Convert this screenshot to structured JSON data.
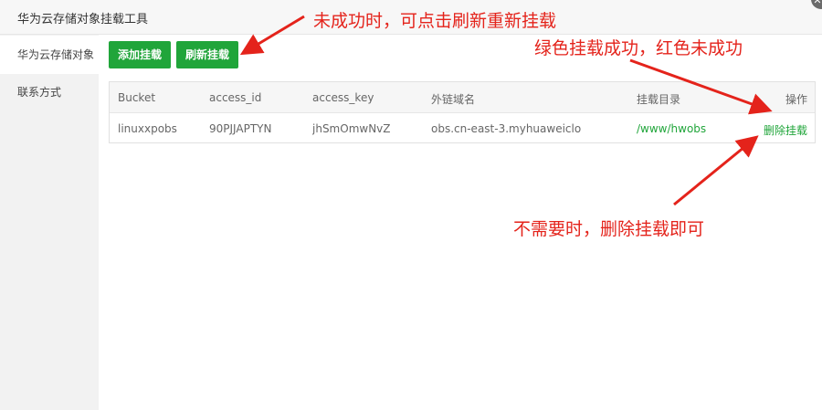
{
  "window": {
    "title": "华为云存储对象挂载工具"
  },
  "sidebar": {
    "items": [
      {
        "label": "华为云存储对象"
      },
      {
        "label": "联系方式"
      }
    ]
  },
  "toolbar": {
    "add_label": "添加挂载",
    "refresh_label": "刷新挂载"
  },
  "table": {
    "columns": [
      "Bucket",
      "access_id",
      "access_key",
      "外链域名",
      "挂载目录",
      "操作"
    ],
    "rows": [
      {
        "bucket": "linuxxpobs",
        "access_id": "90PJJAPTYN",
        "access_key": "jhSmOmwNvZ",
        "domain": "obs.cn-east-3.myhuaweiclo",
        "mount_dir": "/www/hwobs",
        "action": "删除挂载"
      }
    ]
  },
  "annotations": {
    "refresh_note": "未成功时，可点击刷新重新挂载",
    "status_note": "绿色挂载成功，红色未成功",
    "delete_note": "不需要时，删除挂载即可"
  },
  "colors": {
    "accent": "#20a53a",
    "annotation": "#e4231b"
  }
}
